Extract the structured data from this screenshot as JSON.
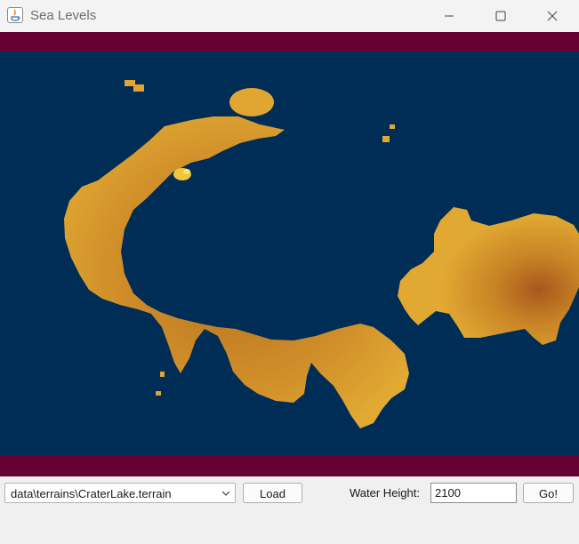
{
  "window": {
    "title": "Sea Levels",
    "controls": [
      "minimize",
      "maximize",
      "close"
    ]
  },
  "colors": {
    "frame": "#660033",
    "water": "#002d55",
    "land_light": "#e0a631",
    "land_dark": "#b36a1f"
  },
  "terrain_selector": {
    "selected": "data\\terrains\\CraterLake.terrain"
  },
  "buttons": {
    "load_label": "Load",
    "go_label": "Go!"
  },
  "water_height": {
    "label": "Water Height:",
    "value": "2100"
  }
}
